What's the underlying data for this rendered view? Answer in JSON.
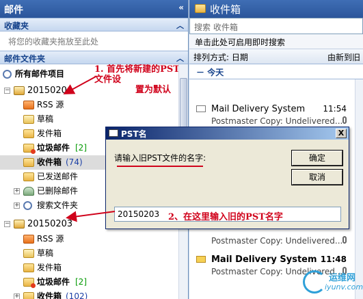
{
  "nav": {
    "title": "邮件",
    "collapse": "«",
    "favorites_header": "收藏夹",
    "favorites_empty": "将您的收藏夹拖放至此处",
    "folders_header": "邮件文件夹",
    "all_items": "所有邮件项目",
    "annotation1_line1": "1. 首先将新建的PST文件设",
    "annotation1_line2": "置为默认",
    "root1": "20150204",
    "root1_items": {
      "rss": "RSS 源",
      "draft": "草稿",
      "outbox": "发件箱",
      "junk": "垃圾邮件",
      "junk_count": "[2]",
      "inbox": "收件箱",
      "inbox_count": "(74)",
      "sent": "已发送邮件",
      "deleted": "已删除邮件",
      "search": "搜索文件夹"
    },
    "root2": "20150203",
    "root2_items": {
      "rss": "RSS 源",
      "draft": "草稿",
      "outbox": "发件箱",
      "junk": "垃圾邮件",
      "junk_count": "[2]",
      "inbox": "收件箱",
      "inbox_count": "(102)"
    }
  },
  "list": {
    "title": "收件箱",
    "search_placeholder": "搜索 收件箱",
    "instant_search": "单击此处可启用即时搜索",
    "sort_label": "排列方式: 日期",
    "sort_right": "由新到旧",
    "group_today": "今天",
    "mails": [
      {
        "from": "Mail Delivery System",
        "time": "11:54",
        "subject": "Postmaster Copy: Undelivered..."
      },
      {
        "from": "",
        "time": "",
        "subject": "Postmaster Copy: Undelivered..."
      },
      {
        "from": "Mail Delivery System",
        "time": "11:48",
        "subject": "Postmaster Copy: Undelivered..."
      }
    ]
  },
  "dialog": {
    "title": "PST名",
    "close": "X",
    "prompt": "请输入旧PST文件的名字:",
    "ok": "确定",
    "cancel": "取消",
    "input_value": "20150203",
    "annotation2": "2、在这里输入旧的PST名字"
  },
  "watermark": {
    "line1": "运维网",
    "line2": "iyunv.com"
  },
  "colors": {
    "header_blue": "#2b559a",
    "annotation_red": "#d0021b",
    "count_green": "#009900"
  }
}
